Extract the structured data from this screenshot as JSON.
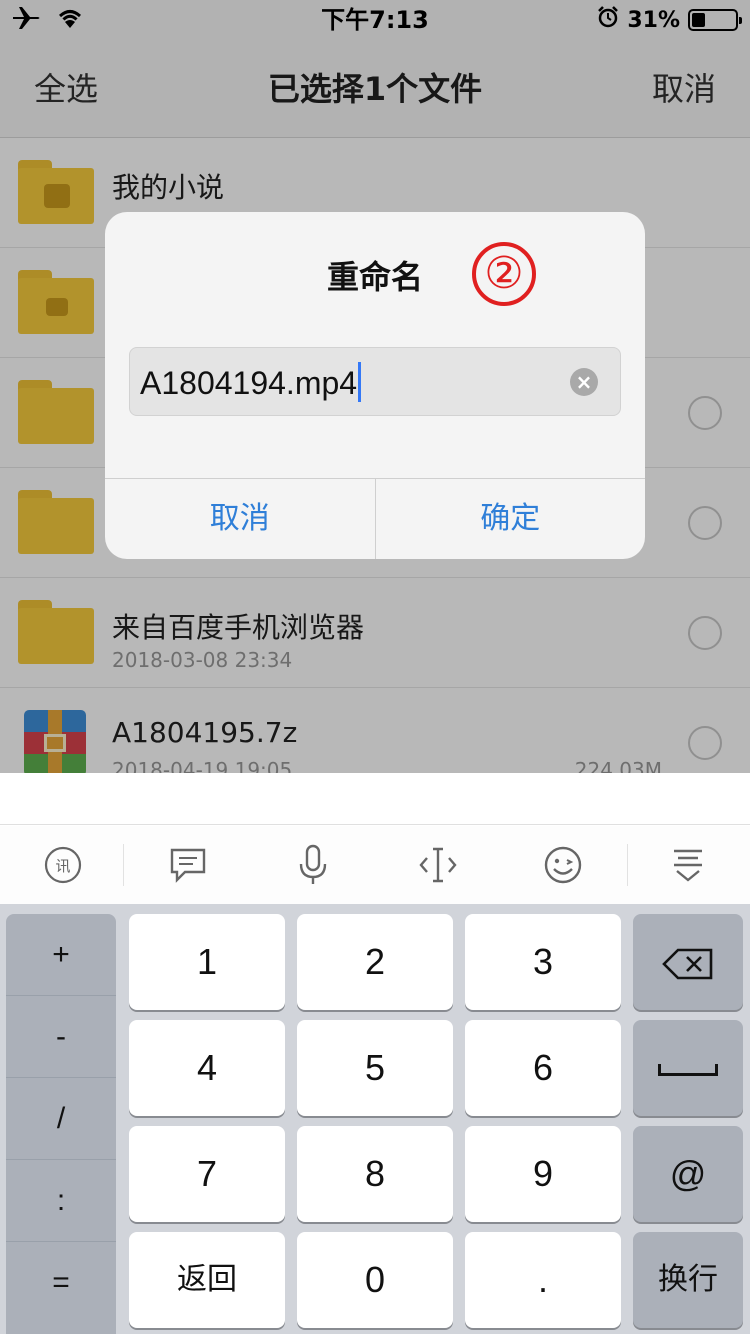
{
  "status_bar": {
    "time": "下午7:13",
    "battery_percent_label": "31%",
    "battery_level": 0.31,
    "left_icons": [
      "airplane-icon",
      "wifi-icon"
    ],
    "right_icons": [
      "alarm-icon",
      "battery-icon"
    ]
  },
  "nav": {
    "select_all": "全选",
    "title": "已选择1个文件",
    "cancel": "取消"
  },
  "files": [
    {
      "name": "我的小说",
      "date": "",
      "size": "",
      "icon": "folder-book-icon",
      "has_radio": false
    },
    {
      "name": "",
      "date": "",
      "size": "",
      "icon": "folder-lock-icon",
      "has_radio": false
    },
    {
      "name": "",
      "date": "",
      "size": "",
      "icon": "folder-icon",
      "has_radio": true
    },
    {
      "name": "",
      "date": "",
      "size": "",
      "icon": "folder-icon",
      "has_radio": true
    },
    {
      "name": "来自百度手机浏览器",
      "date": "2018-03-08 23:34",
      "size": "",
      "icon": "folder-icon",
      "has_radio": true
    },
    {
      "name": "A1804195.7z",
      "date": "2018-04-19 19:05",
      "size": "224.03M",
      "icon": "archive-icon",
      "has_radio": true
    }
  ],
  "dialog": {
    "title": "重命名",
    "step_mark": "②",
    "input_value": "A1804194.mp4",
    "cancel": "取消",
    "confirm": "确定"
  },
  "keyboard": {
    "toolbar_icons": [
      "input-method-icon",
      "chat-bubble-icon",
      "microphone-icon",
      "cursor-move-icon",
      "emoji-icon",
      "keyboard-hide-icon"
    ],
    "side_keys": [
      "+",
      "-",
      "/",
      ":",
      "="
    ],
    "keys": {
      "k1": "1",
      "k2": "2",
      "k3": "3",
      "k4": "4",
      "k5": "5",
      "k6": "6",
      "k7": "7",
      "k8": "8",
      "k9": "9",
      "back": "返回",
      "k0": "0",
      "dot": ".",
      "at": "@",
      "enter": "换行"
    }
  }
}
